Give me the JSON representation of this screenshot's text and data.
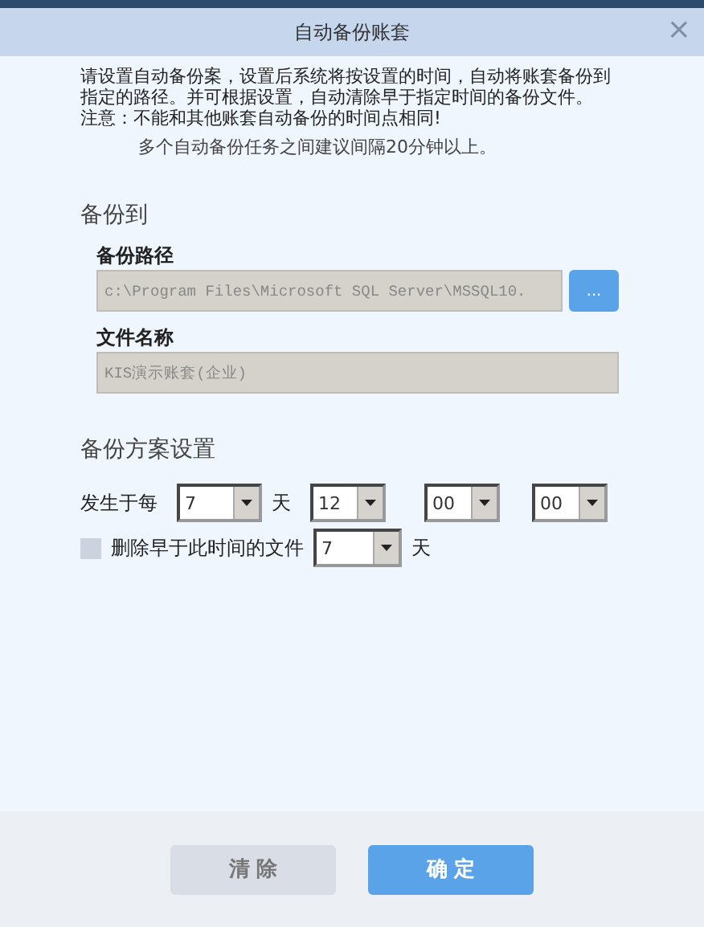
{
  "window": {
    "title": "自动备份账套",
    "close": "×"
  },
  "intro": [
    "请设置自动备份案，设置后系统将按设置的时间，自动将账套备份到指定的路径。并可根据设置，自动清除早于指定时间的备份文件。",
    "注意：不能和其他账套自动备份的时间点相同!"
  ],
  "hint": "多个自动备份任务之间建议间隔20分钟以上。",
  "backup_to": {
    "heading": "备份到",
    "path_label": "备份路径",
    "path_value": "c:\\Program Files\\Microsoft SQL Server\\MSSQL10.",
    "browse": "...",
    "file_label": "文件名称",
    "file_value": "KIS演示账套(企业)"
  },
  "schedule": {
    "heading": "备份方案设置",
    "label": "发生于每",
    "selects": [
      {
        "value": "7",
        "suffix": "天"
      },
      {
        "value": "12"
      },
      {
        "value": "00"
      },
      {
        "value": "00"
      }
    ],
    "delete": {
      "label": "删除早于此时间的文件",
      "checked": false,
      "value": "7",
      "suffix": "天"
    }
  },
  "buttons": [
    {
      "label": "清 除",
      "kind": "secondary"
    },
    {
      "label": "确 定",
      "kind": "primary"
    }
  ]
}
